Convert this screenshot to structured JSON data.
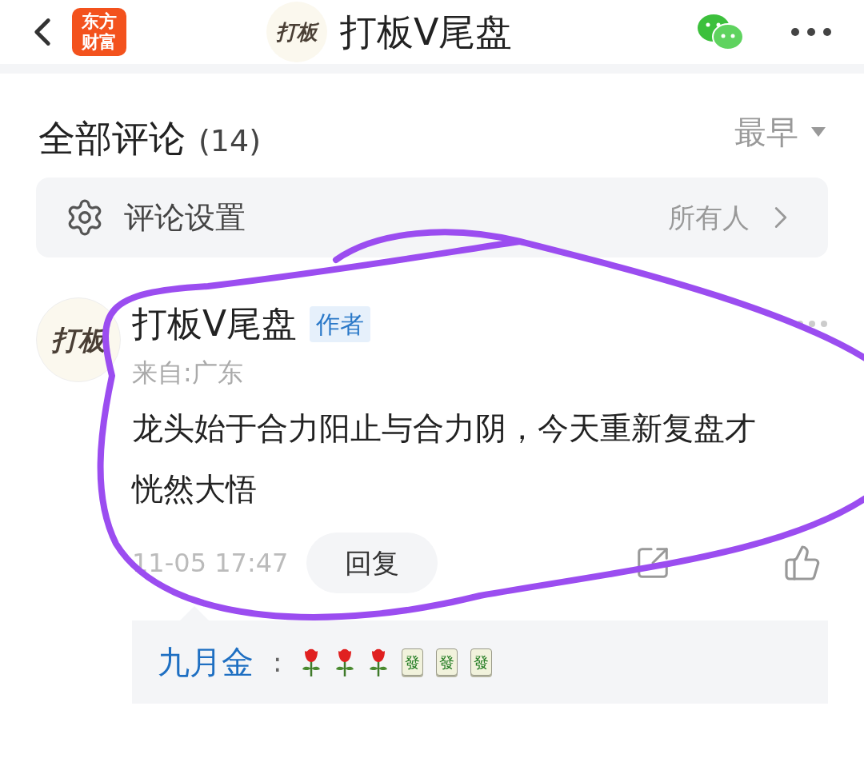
{
  "header": {
    "logo": [
      "东方",
      "财富"
    ],
    "avatar": "打板",
    "title": "打板V尾盘"
  },
  "comments_header": {
    "title": "全部评论",
    "count": "(14)",
    "sort": "最早"
  },
  "settings_row": {
    "label": "评论设置",
    "value": "所有人"
  },
  "comment": {
    "avatar": "打板",
    "author": "打板V尾盘",
    "badge": "作者",
    "location": "来自:广东",
    "text": "龙头始于合力阳止与合力阴，今天重新复盘才恍然大悟",
    "time": "11-05 17:47",
    "reply_button": "回复",
    "reply": {
      "user": "九月金",
      "separator": ":",
      "items": [
        {
          "kind": "rose"
        },
        {
          "kind": "rose"
        },
        {
          "kind": "rose"
        },
        {
          "kind": "tile",
          "text": "發"
        },
        {
          "kind": "tile",
          "text": "發"
        },
        {
          "kind": "tile",
          "text": "發"
        }
      ]
    }
  }
}
